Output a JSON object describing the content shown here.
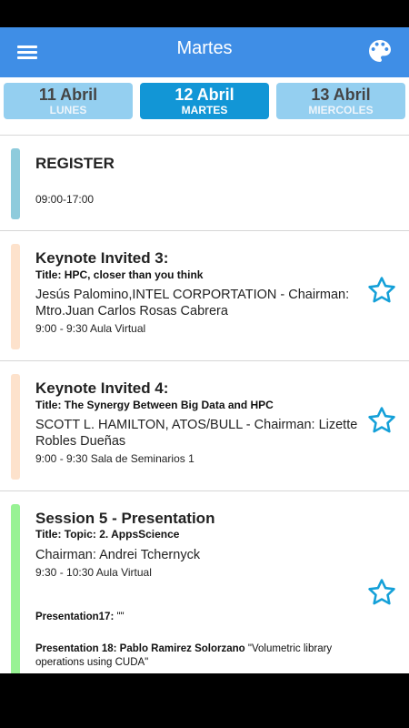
{
  "appbar": {
    "title": "Martes",
    "menu_icon": "hamburger-menu-icon",
    "palette_icon": "palette-icon",
    "color": "#3f8ee6"
  },
  "day_tabs": [
    {
      "date": "11 Abril",
      "weekday": "LUNES",
      "active": false
    },
    {
      "date": "12 Abril",
      "weekday": "MARTES",
      "active": true
    },
    {
      "date": "13 Abril",
      "weekday": "MIERCOLES",
      "active": false
    }
  ],
  "colors": {
    "tab_active": "#1296d6",
    "tab_inactive": "#94cff0",
    "star": "#14a0d8",
    "bar_register": "#8ecbdc",
    "bar_keynote": "#fde2cc",
    "bar_session": "#98f294"
  },
  "events": [
    {
      "title": "REGISTER",
      "time": "09:00-17:00",
      "starred": false
    },
    {
      "title": "Keynote Invited 3:",
      "subtitle": "Title: HPC, closer than you think",
      "speaker": "Jesús Palomino,INTEL CORPORTATION - Chairman: Mtro.Juan Carlos Rosas Cabrera",
      "time": "9:00 - 9:30 Aula Virtual",
      "star_icon": "star-outline-icon"
    },
    {
      "title": "Keynote Invited 4:",
      "subtitle": "Title: The Synergy Between Big Data and HPC",
      "speaker": "SCOTT L. HAMILTON, ATOS/BULL - Chairman: Lizette Robles Dueñas",
      "time": "9:00 - 9:30 Sala de Seminarios 1",
      "star_icon": "star-outline-icon"
    },
    {
      "title": "Session 5 - Presentation",
      "subtitle": "Title: Topic: 2. AppsScience",
      "speaker": "Chairman: Andrei Tchernyck",
      "time": "9:30 - 10:30 Aula Virtual",
      "presentation_17_label": "Presentation17:",
      "presentation_17_text": " \"\"",
      "presentation_18_label": "Presentation 18: Pablo Ramirez Solorzano",
      "presentation_18_text": " \"Volumetric library operations using CUDA\"",
      "star_icon": "star-outline-icon"
    }
  ]
}
